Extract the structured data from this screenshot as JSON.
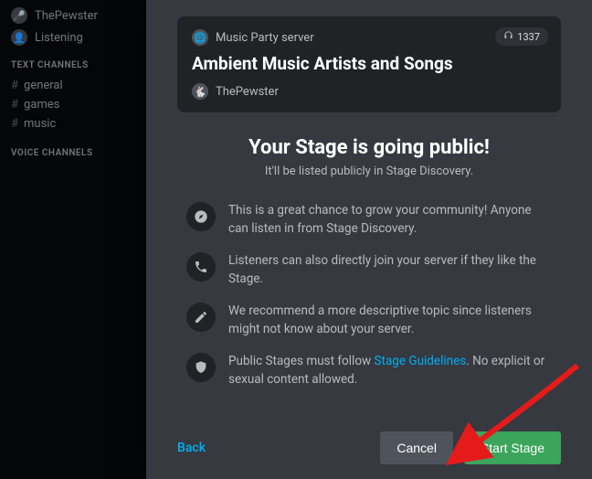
{
  "sidebar": {
    "user_name": "ThePewster",
    "status": "Listening",
    "text_heading": "TEXT CHANNELS",
    "voice_heading": "VOICE CHANNELS",
    "channels": [
      "general",
      "games",
      "music"
    ]
  },
  "card": {
    "server_name": "Music Party server",
    "listener_count": "1337",
    "title": "Ambient Music Artists and Songs",
    "host": "ThePewster"
  },
  "content": {
    "headline": "Your Stage is going public!",
    "subhead": "It'll be listed publicly in Stage Discovery.",
    "rows": [
      {
        "icon": "compass-icon",
        "text": "This is a great chance to grow your community! Anyone can listen in from Stage Discovery."
      },
      {
        "icon": "phone-icon",
        "text": "Listeners can also directly join your server if they like the Stage."
      },
      {
        "icon": "pencil-icon",
        "text": "We recommend a more descriptive topic since listeners might not know about your server."
      },
      {
        "icon": "shield-icon",
        "text_pre": "Public Stages must follow ",
        "link": "Stage Guidelines",
        "text_post": ". No explicit or sexual content allowed."
      }
    ]
  },
  "footer": {
    "back": "Back",
    "cancel": "Cancel",
    "start": "Start Stage"
  }
}
